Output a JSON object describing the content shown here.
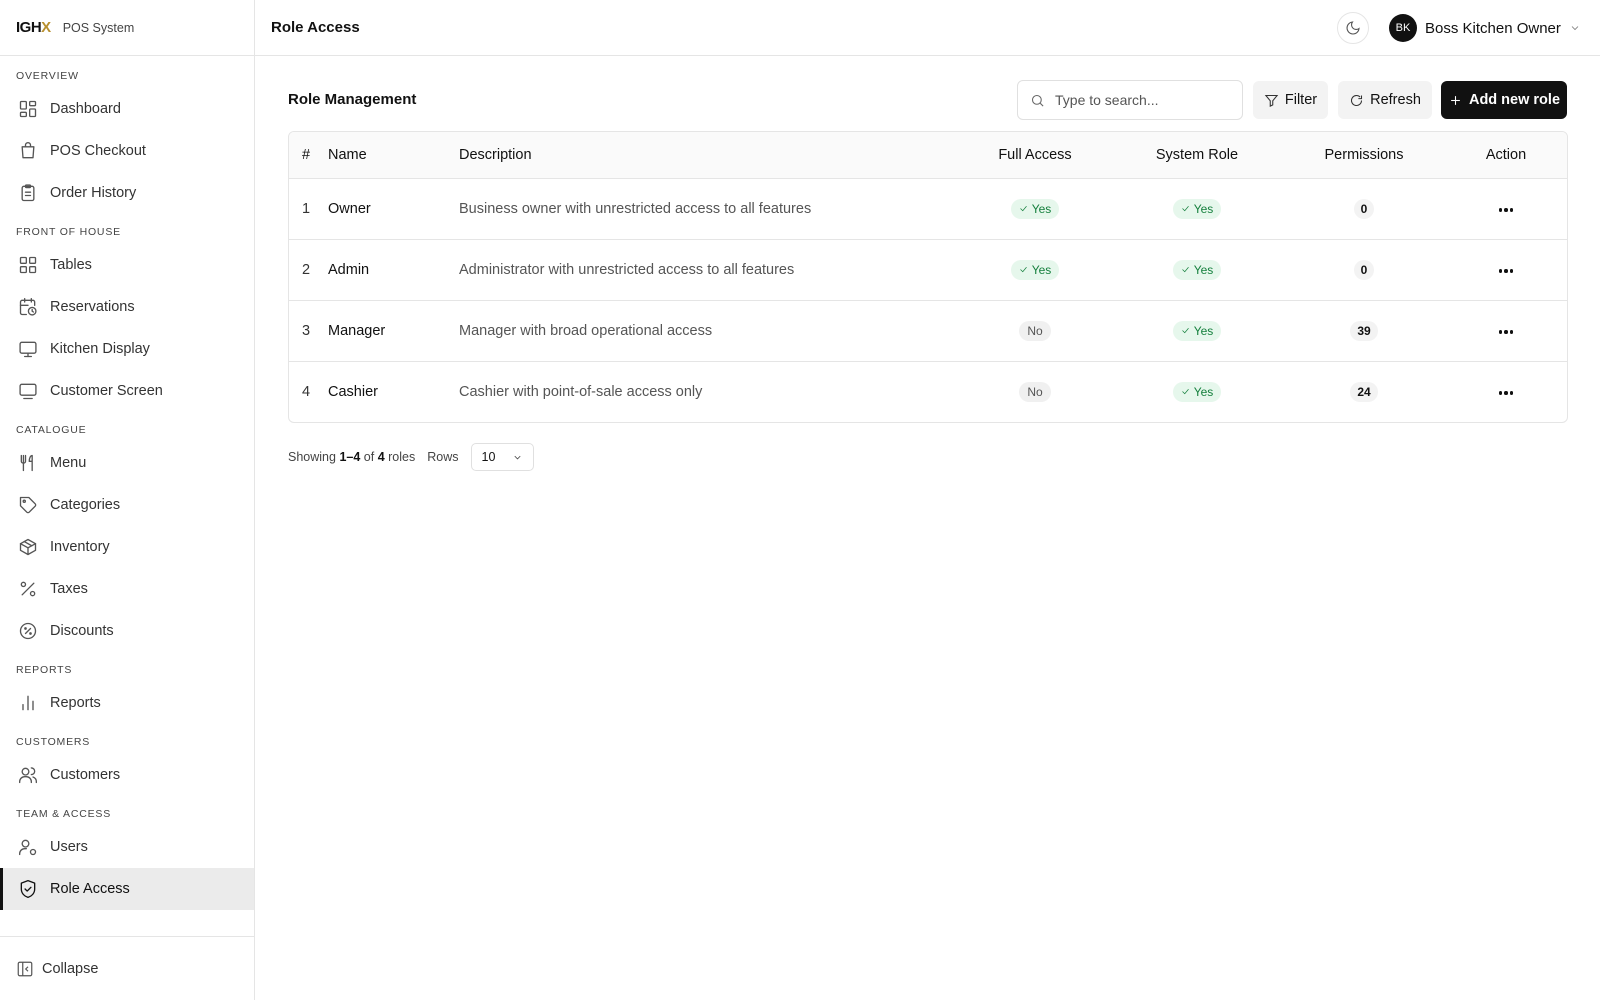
{
  "brand": {
    "logo_main": "IGH",
    "logo_accent": "X",
    "subtitle": "POS System"
  },
  "sidebar": {
    "sections": [
      {
        "title": "OVERVIEW",
        "items": [
          {
            "label": "Dashboard",
            "icon": "dashboard-icon"
          },
          {
            "label": "POS Checkout",
            "icon": "shopping-bag-icon"
          },
          {
            "label": "Order History",
            "icon": "clipboard-icon"
          }
        ]
      },
      {
        "title": "FRONT OF HOUSE",
        "items": [
          {
            "label": "Tables",
            "icon": "grid-icon"
          },
          {
            "label": "Reservations",
            "icon": "calendar-clock-icon"
          },
          {
            "label": "Kitchen Display",
            "icon": "monitor-icon"
          },
          {
            "label": "Customer Screen",
            "icon": "screen-icon"
          }
        ]
      },
      {
        "title": "CATALOGUE",
        "items": [
          {
            "label": "Menu",
            "icon": "utensils-icon"
          },
          {
            "label": "Categories",
            "icon": "tag-icon"
          },
          {
            "label": "Inventory",
            "icon": "package-icon"
          },
          {
            "label": "Taxes",
            "icon": "percent-icon"
          },
          {
            "label": "Discounts",
            "icon": "badge-percent-icon"
          }
        ]
      },
      {
        "title": "REPORTS",
        "items": [
          {
            "label": "Reports",
            "icon": "bar-chart-icon"
          }
        ]
      },
      {
        "title": "CUSTOMERS",
        "items": [
          {
            "label": "Customers",
            "icon": "users-icon"
          }
        ]
      },
      {
        "title": "TEAM & ACCESS",
        "items": [
          {
            "label": "Users",
            "icon": "user-cog-icon"
          },
          {
            "label": "Role Access",
            "icon": "shield-check-icon",
            "active": true
          }
        ]
      }
    ],
    "collapse_label": "Collapse"
  },
  "header": {
    "title": "Role Access",
    "user": {
      "initials": "BK",
      "name": "Boss Kitchen Owner"
    }
  },
  "main": {
    "heading": "Role Management",
    "search": {
      "placeholder": "Type to search...",
      "value": ""
    },
    "filter_label": "Filter",
    "refresh_label": "Refresh",
    "add_label": "Add new role",
    "table": {
      "columns": [
        "#",
        "Name",
        "Description",
        "Full Access",
        "System Role",
        "Permissions",
        "Action"
      ],
      "rows": [
        {
          "num": "1",
          "name": "Owner",
          "description": "Business owner with unrestricted access to all features",
          "full_access": "Yes",
          "system_role": "Yes",
          "permissions": "0"
        },
        {
          "num": "2",
          "name": "Admin",
          "description": "Administrator with unrestricted access to all features",
          "full_access": "Yes",
          "system_role": "Yes",
          "permissions": "0"
        },
        {
          "num": "3",
          "name": "Manager",
          "description": "Manager with broad operational access",
          "full_access": "No",
          "system_role": "Yes",
          "permissions": "39"
        },
        {
          "num": "4",
          "name": "Cashier",
          "description": "Cashier with point-of-sale access only",
          "full_access": "No",
          "system_role": "Yes",
          "permissions": "24"
        }
      ]
    },
    "pager": {
      "showing_prefix": "Showing",
      "range": "1–4",
      "of_text": "of",
      "total": "4",
      "suffix": "roles",
      "rows_label": "Rows",
      "rows_value": "10"
    }
  },
  "colors": {
    "accent": "#111111",
    "logo_accent": "#b8902f",
    "yes_bg": "#e6f7ec",
    "yes_text": "#15803d",
    "active_bg": "#ebebeb"
  }
}
